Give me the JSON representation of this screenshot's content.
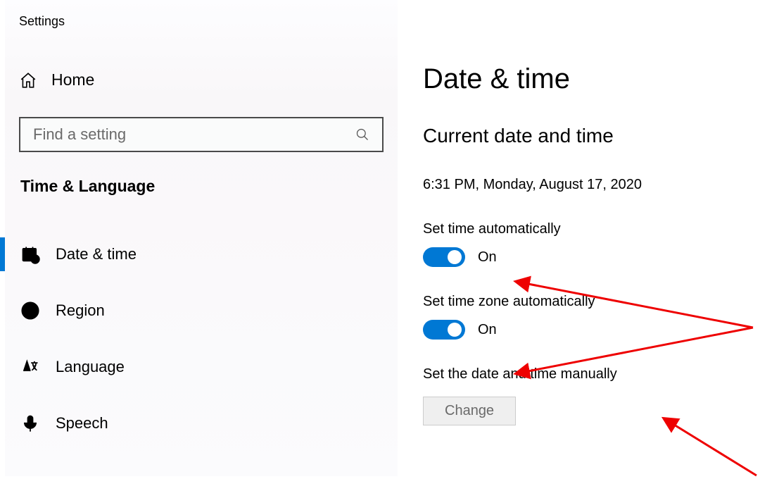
{
  "window_title": "Settings",
  "sidebar": {
    "home_label": "Home",
    "search_placeholder": "Find a setting",
    "category": "Time & Language",
    "items": [
      {
        "label": "Date & time"
      },
      {
        "label": "Region"
      },
      {
        "label": "Language"
      },
      {
        "label": "Speech"
      }
    ]
  },
  "main": {
    "title": "Date & time",
    "section": "Current date and time",
    "current": "6:31 PM, Monday, August 17, 2020",
    "toggle1": {
      "label": "Set time automatically",
      "state": "On"
    },
    "toggle2": {
      "label": "Set time zone automatically",
      "state": "On"
    },
    "manual": {
      "label": "Set the date and time manually",
      "button": "Change"
    }
  }
}
